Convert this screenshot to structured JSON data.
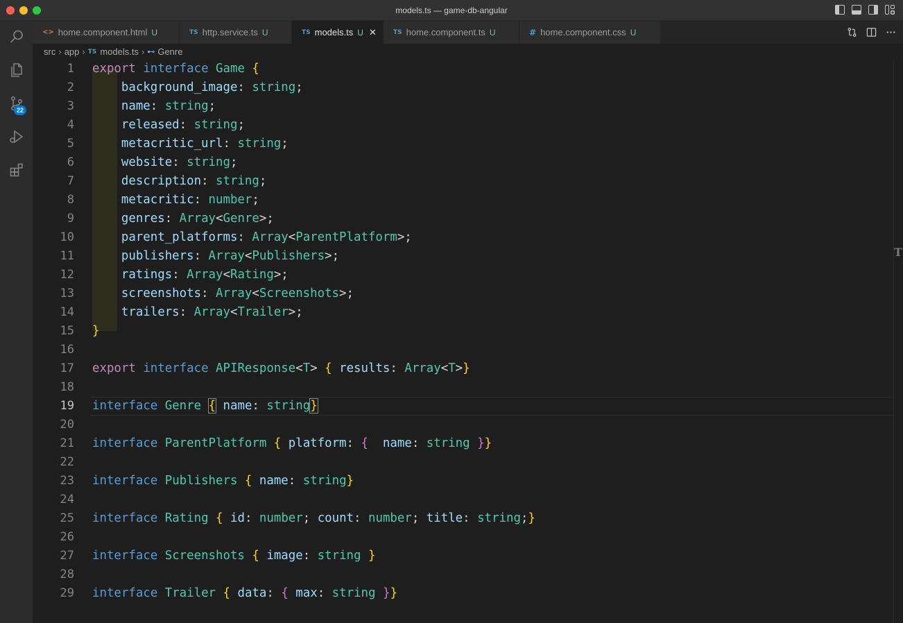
{
  "window": {
    "title": "models.ts — game-db-angular"
  },
  "activity_bar": {
    "source_control_badge": "22"
  },
  "tabs": [
    {
      "icon": "<>",
      "label": "home.component.html",
      "status": "U"
    },
    {
      "icon": "TS",
      "label": "http.service.ts",
      "status": "U"
    },
    {
      "icon": "TS",
      "label": "models.ts",
      "status": "U",
      "close": "✕"
    },
    {
      "icon": "TS",
      "label": "home.component.ts",
      "status": "U"
    },
    {
      "icon": "#",
      "label": "home.component.css",
      "status": "U"
    }
  ],
  "breadcrumb": {
    "parts": [
      "src",
      "app",
      "models.ts",
      "Genre"
    ],
    "ts_icon": "TS"
  },
  "editor": {
    "active_line": 19,
    "line_numbers": [
      "1",
      "2",
      "3",
      "4",
      "5",
      "6",
      "7",
      "8",
      "9",
      "10",
      "11",
      "12",
      "13",
      "14",
      "15",
      "16",
      "17",
      "18",
      "19",
      "20",
      "21",
      "22",
      "23",
      "24",
      "25",
      "26",
      "27",
      "28",
      "29"
    ],
    "lines": [
      [
        [
          "kw",
          "export"
        ],
        [
          "pu",
          " "
        ],
        [
          "kw2",
          "interface"
        ],
        [
          "pu",
          " "
        ],
        [
          "ty",
          "Game"
        ],
        [
          "pu",
          " "
        ],
        [
          "br1",
          "{"
        ]
      ],
      [
        [
          "pu",
          "    "
        ],
        [
          "pr",
          "background_image"
        ],
        [
          "pu",
          ": "
        ],
        [
          "ty",
          "string"
        ],
        [
          "pu",
          ";"
        ]
      ],
      [
        [
          "pu",
          "    "
        ],
        [
          "pr",
          "name"
        ],
        [
          "pu",
          ": "
        ],
        [
          "ty",
          "string"
        ],
        [
          "pu",
          ";"
        ]
      ],
      [
        [
          "pu",
          "    "
        ],
        [
          "pr",
          "released"
        ],
        [
          "pu",
          ": "
        ],
        [
          "ty",
          "string"
        ],
        [
          "pu",
          ";"
        ]
      ],
      [
        [
          "pu",
          "    "
        ],
        [
          "pr",
          "metacritic_url"
        ],
        [
          "pu",
          ": "
        ],
        [
          "ty",
          "string"
        ],
        [
          "pu",
          ";"
        ]
      ],
      [
        [
          "pu",
          "    "
        ],
        [
          "pr",
          "website"
        ],
        [
          "pu",
          ": "
        ],
        [
          "ty",
          "string"
        ],
        [
          "pu",
          ";"
        ]
      ],
      [
        [
          "pu",
          "    "
        ],
        [
          "pr",
          "description"
        ],
        [
          "pu",
          ": "
        ],
        [
          "ty",
          "string"
        ],
        [
          "pu",
          ";"
        ]
      ],
      [
        [
          "pu",
          "    "
        ],
        [
          "pr",
          "metacritic"
        ],
        [
          "pu",
          ": "
        ],
        [
          "ty",
          "number"
        ],
        [
          "pu",
          ";"
        ]
      ],
      [
        [
          "pu",
          "    "
        ],
        [
          "pr",
          "genres"
        ],
        [
          "pu",
          ": "
        ],
        [
          "ty",
          "Array"
        ],
        [
          "pu",
          "<"
        ],
        [
          "ty",
          "Genre"
        ],
        [
          "pu",
          ">;"
        ]
      ],
      [
        [
          "pu",
          "    "
        ],
        [
          "pr",
          "parent_platforms"
        ],
        [
          "pu",
          ": "
        ],
        [
          "ty",
          "Array"
        ],
        [
          "pu",
          "<"
        ],
        [
          "ty",
          "ParentPlatform"
        ],
        [
          "pu",
          ">;"
        ]
      ],
      [
        [
          "pu",
          "    "
        ],
        [
          "pr",
          "publishers"
        ],
        [
          "pu",
          ": "
        ],
        [
          "ty",
          "Array"
        ],
        [
          "pu",
          "<"
        ],
        [
          "ty",
          "Publishers"
        ],
        [
          "pu",
          ">;"
        ]
      ],
      [
        [
          "pu",
          "    "
        ],
        [
          "pr",
          "ratings"
        ],
        [
          "pu",
          ": "
        ],
        [
          "ty",
          "Array"
        ],
        [
          "pu",
          "<"
        ],
        [
          "ty",
          "Rating"
        ],
        [
          "pu",
          ">;"
        ]
      ],
      [
        [
          "pu",
          "    "
        ],
        [
          "pr",
          "screenshots"
        ],
        [
          "pu",
          ": "
        ],
        [
          "ty",
          "Array"
        ],
        [
          "pu",
          "<"
        ],
        [
          "ty",
          "Screenshots"
        ],
        [
          "pu",
          ">;"
        ]
      ],
      [
        [
          "pu",
          "    "
        ],
        [
          "pr",
          "trailers"
        ],
        [
          "pu",
          ": "
        ],
        [
          "ty",
          "Array"
        ],
        [
          "pu",
          "<"
        ],
        [
          "ty",
          "Trailer"
        ],
        [
          "pu",
          ">;"
        ]
      ],
      [
        [
          "br1",
          "}"
        ]
      ],
      [],
      [
        [
          "kw",
          "export"
        ],
        [
          "pu",
          " "
        ],
        [
          "kw2",
          "interface"
        ],
        [
          "pu",
          " "
        ],
        [
          "ty",
          "APIResponse"
        ],
        [
          "pu",
          "<"
        ],
        [
          "ty",
          "T"
        ],
        [
          "pu",
          "> "
        ],
        [
          "br1",
          "{"
        ],
        [
          "pu",
          " "
        ],
        [
          "pr",
          "results"
        ],
        [
          "pu",
          ": "
        ],
        [
          "ty",
          "Array"
        ],
        [
          "pu",
          "<"
        ],
        [
          "ty",
          "T"
        ],
        [
          "pu",
          ">"
        ],
        [
          "br1",
          "}"
        ]
      ],
      [],
      [
        [
          "kw2",
          "interface"
        ],
        [
          "pu",
          " "
        ],
        [
          "ty",
          "Genre"
        ],
        [
          "pu",
          " "
        ],
        [
          "br1",
          "{"
        ],
        [
          "pu",
          " "
        ],
        [
          "pr",
          "name"
        ],
        [
          "pu",
          ": "
        ],
        [
          "ty",
          "string"
        ],
        [
          "br1",
          "}"
        ]
      ],
      [],
      [
        [
          "kw2",
          "interface"
        ],
        [
          "pu",
          " "
        ],
        [
          "ty",
          "ParentPlatform"
        ],
        [
          "pu",
          " "
        ],
        [
          "br1",
          "{"
        ],
        [
          "pu",
          " "
        ],
        [
          "pr",
          "platform"
        ],
        [
          "pu",
          ": "
        ],
        [
          "br2",
          "{"
        ],
        [
          "pu",
          "  "
        ],
        [
          "pr",
          "name"
        ],
        [
          "pu",
          ": "
        ],
        [
          "ty",
          "string"
        ],
        [
          "pu",
          " "
        ],
        [
          "br2",
          "}"
        ],
        [
          "br1",
          "}"
        ]
      ],
      [],
      [
        [
          "kw2",
          "interface"
        ],
        [
          "pu",
          " "
        ],
        [
          "ty",
          "Publishers"
        ],
        [
          "pu",
          " "
        ],
        [
          "br1",
          "{"
        ],
        [
          "pu",
          " "
        ],
        [
          "pr",
          "name"
        ],
        [
          "pu",
          ": "
        ],
        [
          "ty",
          "string"
        ],
        [
          "br1",
          "}"
        ]
      ],
      [],
      [
        [
          "kw2",
          "interface"
        ],
        [
          "pu",
          " "
        ],
        [
          "ty",
          "Rating"
        ],
        [
          "pu",
          " "
        ],
        [
          "br1",
          "{"
        ],
        [
          "pu",
          " "
        ],
        [
          "pr",
          "id"
        ],
        [
          "pu",
          ": "
        ],
        [
          "ty",
          "number"
        ],
        [
          "pu",
          "; "
        ],
        [
          "pr",
          "count"
        ],
        [
          "pu",
          ": "
        ],
        [
          "ty",
          "number"
        ],
        [
          "pu",
          "; "
        ],
        [
          "pr",
          "title"
        ],
        [
          "pu",
          ": "
        ],
        [
          "ty",
          "string"
        ],
        [
          "pu",
          ";"
        ],
        [
          "br1",
          "}"
        ]
      ],
      [],
      [
        [
          "kw2",
          "interface"
        ],
        [
          "pu",
          " "
        ],
        [
          "ty",
          "Screenshots"
        ],
        [
          "pu",
          " "
        ],
        [
          "br1",
          "{"
        ],
        [
          "pu",
          " "
        ],
        [
          "pr",
          "image"
        ],
        [
          "pu",
          ": "
        ],
        [
          "ty",
          "string"
        ],
        [
          "pu",
          " "
        ],
        [
          "br1",
          "}"
        ]
      ],
      [],
      [
        [
          "kw2",
          "interface"
        ],
        [
          "pu",
          " "
        ],
        [
          "ty",
          "Trailer"
        ],
        [
          "pu",
          " "
        ],
        [
          "br1",
          "{"
        ],
        [
          "pu",
          " "
        ],
        [
          "pr",
          "data"
        ],
        [
          "pu",
          ": "
        ],
        [
          "br2",
          "{"
        ],
        [
          "pu",
          " "
        ],
        [
          "pr",
          "max"
        ],
        [
          "pu",
          ": "
        ],
        [
          "ty",
          "string"
        ],
        [
          "pu",
          " "
        ],
        [
          "br2",
          "}"
        ],
        [
          "br1",
          "}"
        ]
      ]
    ]
  },
  "scrollbar": {
    "marker": "T"
  },
  "colors": {
    "keyword_export": "#c586c0",
    "keyword_interface": "#569cd6",
    "type": "#4ec9b0",
    "property": "#9cdcfe",
    "bracket_level1": "#ffd700",
    "bracket_level2": "#da70d6",
    "badge": "#0078d4",
    "untracked_status": "#73c991"
  },
  "icons": {
    "activity": [
      "search-icon",
      "explorer-icon",
      "source-control-icon",
      "run-debug-icon",
      "extensions-icon"
    ],
    "layout": [
      "toggle-primary-sidebar-icon",
      "toggle-panel-icon",
      "toggle-secondary-sidebar-icon",
      "customize-layout-icon"
    ],
    "editor_actions": [
      "open-changes-icon",
      "split-editor-icon",
      "more-actions-icon"
    ]
  }
}
